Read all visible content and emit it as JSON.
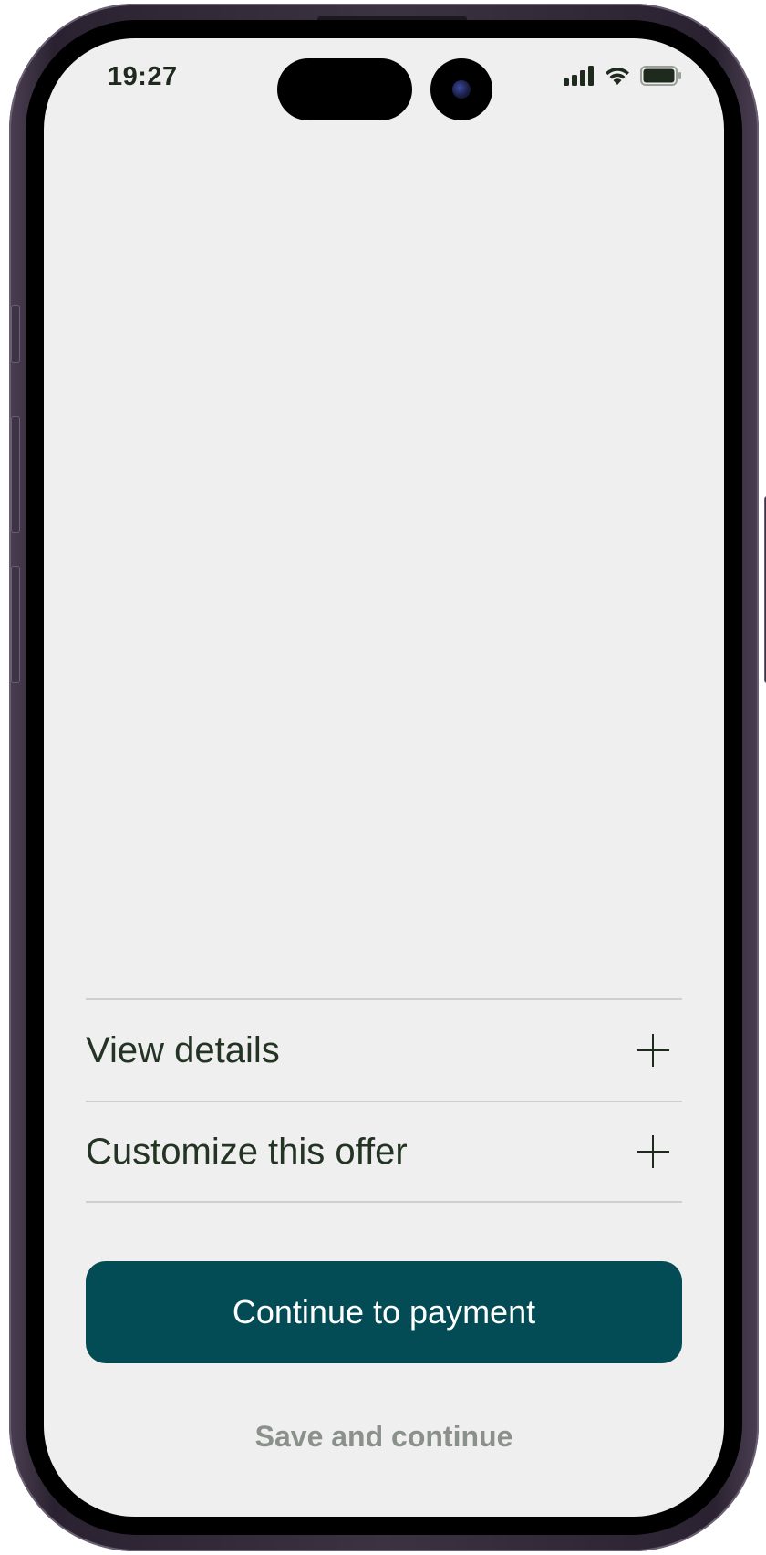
{
  "status_bar": {
    "time": "19:27",
    "icons": [
      "cellular-signal-icon",
      "wifi-icon",
      "battery-icon"
    ]
  },
  "accordion": {
    "items": [
      {
        "label": "View details",
        "icon": "plus-icon"
      },
      {
        "label": "Customize this offer",
        "icon": "plus-icon"
      }
    ]
  },
  "actions": {
    "primary_label": "Continue to payment",
    "secondary_label": "Save and continue"
  },
  "colors": {
    "screen_background": "#efefef",
    "primary_button": "#034b55",
    "text_dark": "#243424",
    "text_muted": "#8a908a",
    "divider": "#cfcfcf"
  }
}
